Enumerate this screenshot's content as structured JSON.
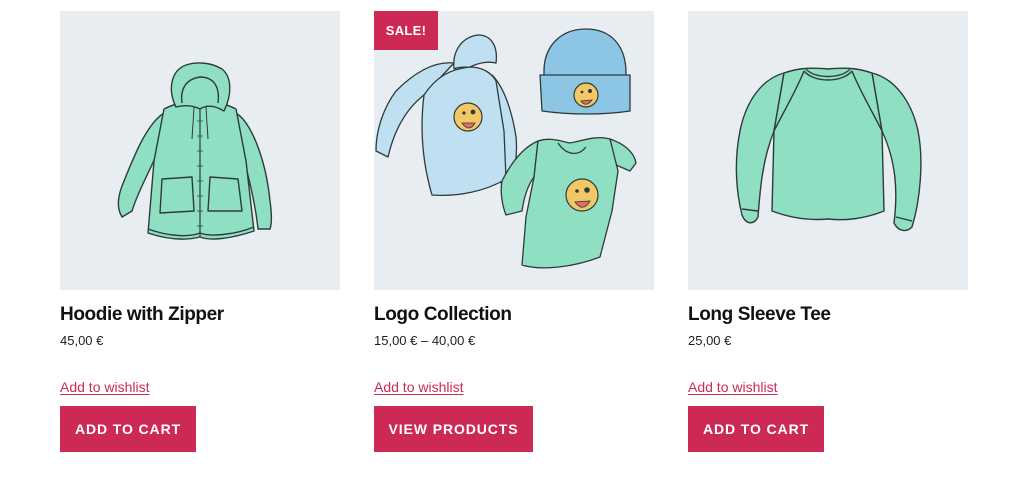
{
  "colors": {
    "accent": "#cc2a55",
    "image_background": "#e8edf1",
    "garment_mint": "#8fe0c3",
    "garment_blue": "#bfe0f0",
    "beanie_blue": "#8cc6e4",
    "emoji_yellow": "#f2c766"
  },
  "products": [
    {
      "image_icon": "hoodie-with-zipper-image",
      "title": "Hoodie with Zipper",
      "price": "45,00 €",
      "wishlist_label": "Add to wishlist",
      "button_label": "ADD TO CART"
    },
    {
      "image_icon": "logo-collection-image",
      "sale_badge": "SALE!",
      "title": "Logo Collection",
      "price": "15,00 € – 40,00 €",
      "wishlist_label": "Add to wishlist",
      "button_label": "VIEW PRODUCTS"
    },
    {
      "image_icon": "long-sleeve-tee-image",
      "title": "Long Sleeve Tee",
      "price": "25,00 €",
      "wishlist_label": "Add to wishlist",
      "button_label": "ADD TO CART"
    }
  ]
}
